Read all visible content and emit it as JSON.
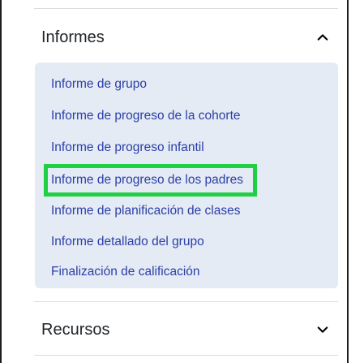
{
  "sections": {
    "informes": {
      "title": "Informes",
      "expanded": true,
      "items": [
        {
          "label": "Informe de grupo"
        },
        {
          "label": "Informe de progreso de la cohorte"
        },
        {
          "label": "Informe de progreso infantil"
        },
        {
          "label": "Informe de progreso de los padres"
        },
        {
          "label": "Informe de planificación de clases"
        },
        {
          "label": "Informe detallado del grupo"
        },
        {
          "label": "Finalización de calificación"
        }
      ]
    },
    "recursos": {
      "title": "Recursos",
      "expanded": false
    }
  },
  "icons": {
    "informes_toggle": "chevron-up-icon",
    "recursos_toggle": "chevron-down-icon"
  },
  "colors": {
    "link": "#2b3ea8",
    "panel_background": "#e4ebf4",
    "highlight": "#1fd045",
    "title_text": "#212529"
  }
}
